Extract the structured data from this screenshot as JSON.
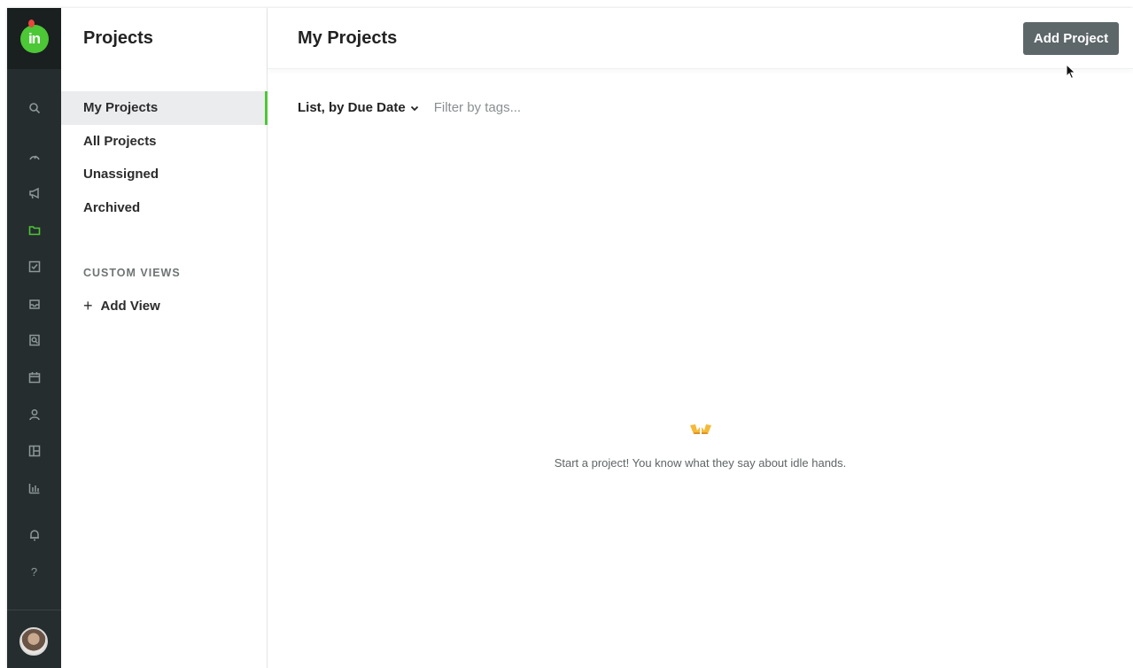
{
  "sidebar": {
    "title": "Projects",
    "items": [
      {
        "label": "My Projects",
        "active": true
      },
      {
        "label": "All Projects",
        "active": false
      },
      {
        "label": "Unassigned",
        "active": false
      },
      {
        "label": "Archived",
        "active": false
      }
    ],
    "custom_views_label": "CUSTOM VIEWS",
    "add_view_label": "Add View"
  },
  "main": {
    "title": "My Projects",
    "add_button_label": "Add Project",
    "sort_label": "List, by Due Date",
    "tag_filter_placeholder": "Filter by tags...",
    "empty_message": "Start a project! You know what they say about idle hands."
  },
  "rail": {
    "icons": [
      "search-icon",
      "dashboard-icon",
      "megaphone-icon",
      "folder-icon",
      "checkbox-icon",
      "inbox-icon",
      "review-icon",
      "calendar-icon",
      "person-icon",
      "board-icon",
      "chart-icon",
      "bell-icon",
      "help-icon"
    ],
    "active_icon": "folder-icon"
  },
  "colors": {
    "accent": "#4cc736",
    "rail_bg": "#262d2e",
    "button_bg": "#5d676a"
  }
}
